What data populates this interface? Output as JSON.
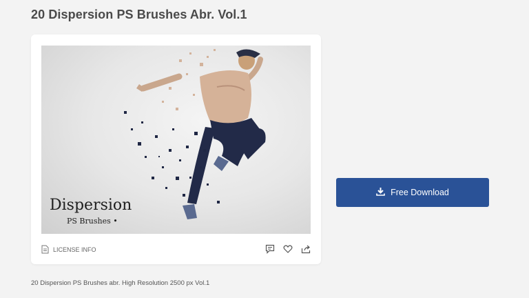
{
  "page": {
    "title": "20 Dispersion PS Brushes Abr. Vol.1",
    "caption": "20 Dispersion PS Brushes abr. High Resolution 2500 px Vol.1"
  },
  "preview": {
    "title": "Dispersion",
    "subtitle": "PS Brushes"
  },
  "card": {
    "license_label": "LICENSE INFO",
    "actions": [
      "comment-icon",
      "heart-icon",
      "share-icon"
    ]
  },
  "download": {
    "label": "Free Download",
    "color": "#2a5297"
  },
  "colors": {
    "background": "#f3f3f3",
    "card": "#ffffff",
    "accent": "#2a5297"
  }
}
